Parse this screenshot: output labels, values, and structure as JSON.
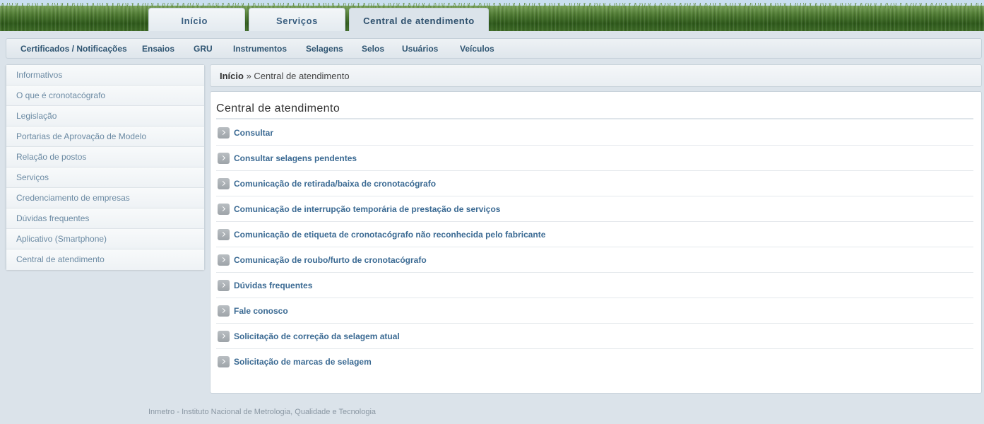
{
  "top_tabs": [
    "Início",
    "Serviços",
    "Central de atendimento"
  ],
  "subnav": [
    "Certificados / Notificações",
    "Ensaios",
    "GRU",
    "Instrumentos",
    "Selagens",
    "Selos",
    "Usuários",
    "Veículos"
  ],
  "sidebar": [
    "Informativos",
    "O que é cronotacógrafo",
    "Legislação",
    "Portarias de Aprovação de Modelo",
    "Relação de postos",
    "Serviços",
    "Credenciamento de empresas",
    "Dúvidas frequentes",
    "Aplicativo (Smartphone)",
    "Central de atendimento"
  ],
  "breadcrumb": {
    "home": "Início",
    "separator": " » ",
    "current": "Central de atendimento"
  },
  "content": {
    "title": "Central de atendimento",
    "links": [
      "Consultar",
      "Consultar selagens pendentes",
      "Comunicação de retirada/baixa de cronotacógrafo",
      "Comunicação de interrupção temporária de prestação de serviços",
      "Comunicação de etiqueta de cronotacógrafo não reconhecida pelo fabricante",
      "Comunicação de roubo/furto de cronotacógrafo",
      "Dúvidas frequentes",
      "Fale conosco",
      "Solicitação de correção da selagem atual",
      "Solicitação de marcas de selagem"
    ]
  },
  "footer": "Inmetro - Instituto Nacional de Metrologia, Qualidade e Tecnologia"
}
